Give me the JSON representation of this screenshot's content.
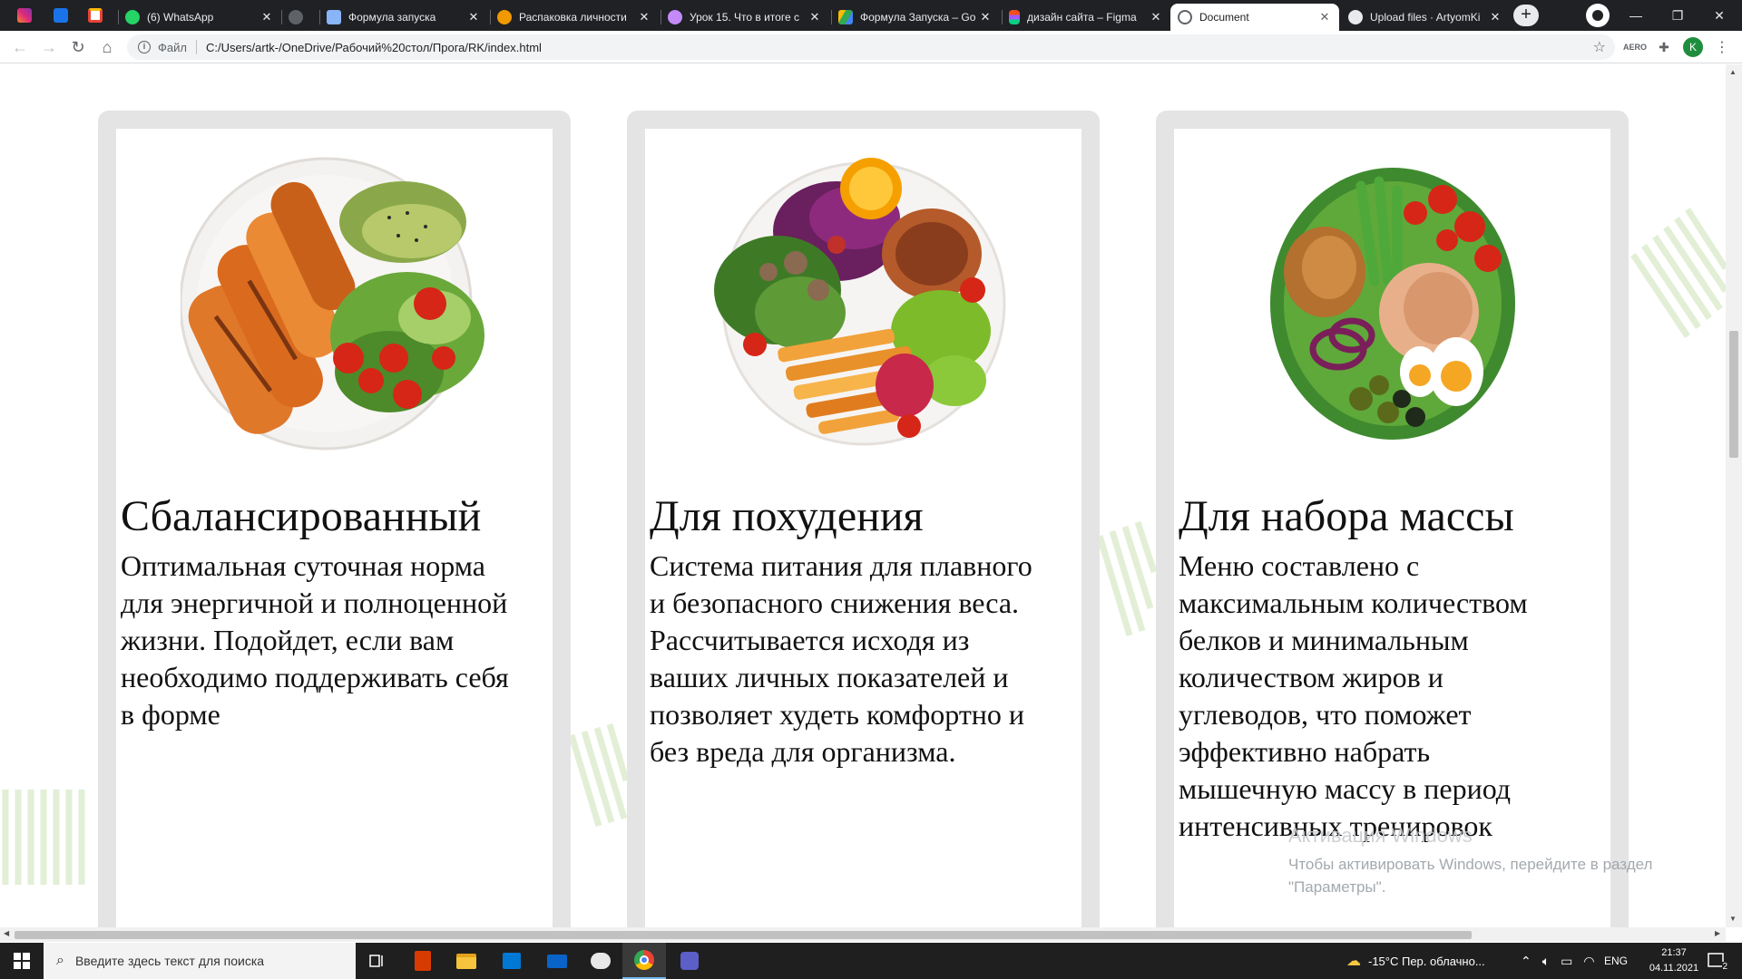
{
  "browser": {
    "pinned_tabs": [
      {
        "icon": "instagram-icon",
        "color": "#d6249f"
      },
      {
        "icon": "chat-icon",
        "color": "#1a73e8"
      },
      {
        "icon": "gmail-icon",
        "color": "#ea4335"
      }
    ],
    "tabs": [
      {
        "title": "(6) WhatsApp",
        "icon": "whatsapp-icon",
        "color": "#25d366"
      },
      {
        "title": "",
        "icon": "blank-tab-icon",
        "color": "#5f6368"
      },
      {
        "title": "Формула запуска",
        "icon": "rocket-icon",
        "color": "#8ab4f8"
      },
      {
        "title": "Распаковка личности",
        "icon": "heart-icon",
        "color": "#f29900"
      },
      {
        "title": "Урок 15. Что в итоге с",
        "icon": "course-icon",
        "color": "#c58af9"
      },
      {
        "title": "Формула Запуска – Go",
        "icon": "drive-icon",
        "color": "#34a853"
      },
      {
        "title": "дизайн сайта – Figma",
        "icon": "figma-icon",
        "color": "#f24e1e"
      },
      {
        "title": "Document",
        "icon": "globe-icon",
        "color": "#5f6368"
      },
      {
        "title": "Upload files · ArtyomKi",
        "icon": "github-icon",
        "color": "#e8eaed"
      }
    ],
    "address": {
      "scheme_label": "Файл",
      "url": "C:/Users/artk-/OneDrive/Рабочий%20стол/Прога/RK/index.html"
    },
    "profile_initial": "K"
  },
  "page": {
    "accent_color": "#e2efd6",
    "cards": [
      {
        "title": "Сбалансированный",
        "text": "Оптимальная суточная норма для энергичной и полноценной жизни. Подойдет, если вам необходимо поддерживать себя в форме"
      },
      {
        "title": "Для похудения",
        "text": "Система питания для плавного и безопасного снижения веса. Рассчитывается исходя из ваших личных показателей и позволяет худеть комфортно и без вреда для организма."
      },
      {
        "title": "Для набора массы",
        "text": "Меню составлено с максимальным количеством белков и минимальным количеством жиров и углеводов, что поможет эффективно набрать мышечную массу в период интенсивных тренировок"
      }
    ],
    "watermark": {
      "title": "Активация Windows",
      "line1": "Чтобы активировать Windows, перейдите в раздел",
      "line2": "\"Параметры\"."
    }
  },
  "taskbar": {
    "search_placeholder": "Введите здесь текст для поиска",
    "weather": "-15°C  Пер. облачно...",
    "language": "ENG",
    "time": "21:37",
    "date": "04.11.2021",
    "notifications": "2"
  }
}
